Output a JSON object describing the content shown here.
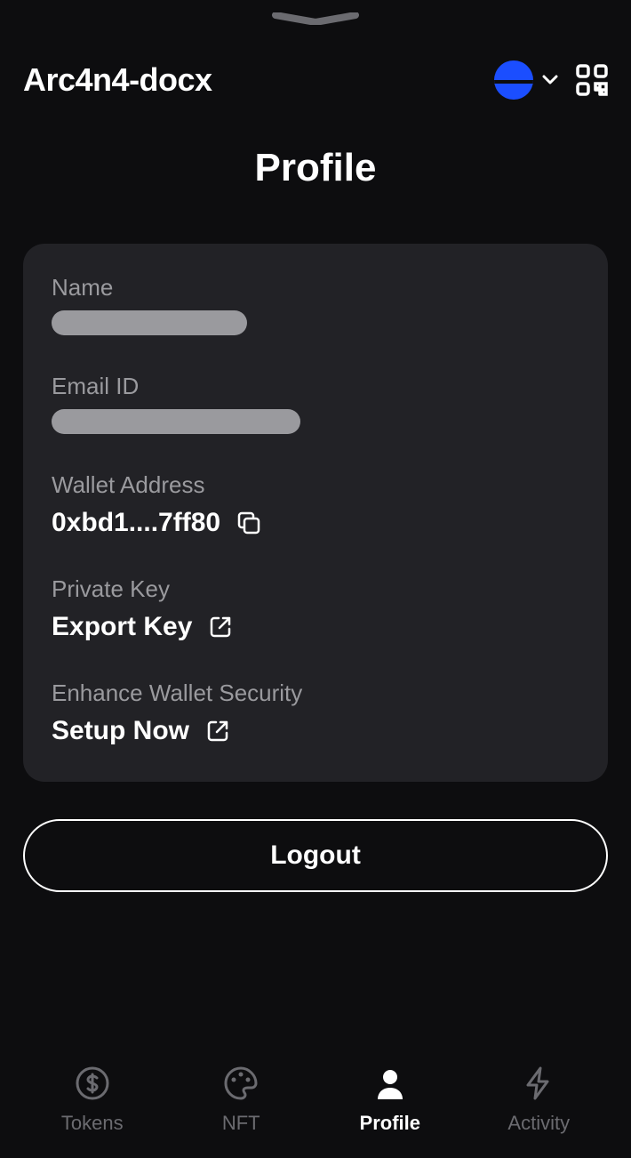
{
  "header": {
    "app_title": "Arc4n4-docx"
  },
  "page": {
    "title": "Profile"
  },
  "profile": {
    "name_label": "Name",
    "name_value": "",
    "email_label": "Email ID",
    "email_value": "",
    "wallet_label": "Wallet Address",
    "wallet_value": "0xbd1....7ff80",
    "private_key_label": "Private Key",
    "private_key_action": "Export Key",
    "security_label": "Enhance Wallet Security",
    "security_action": "Setup Now"
  },
  "buttons": {
    "logout": "Logout"
  },
  "tabs": {
    "tokens": "Tokens",
    "nft": "NFT",
    "profile": "Profile",
    "activity": "Activity"
  }
}
